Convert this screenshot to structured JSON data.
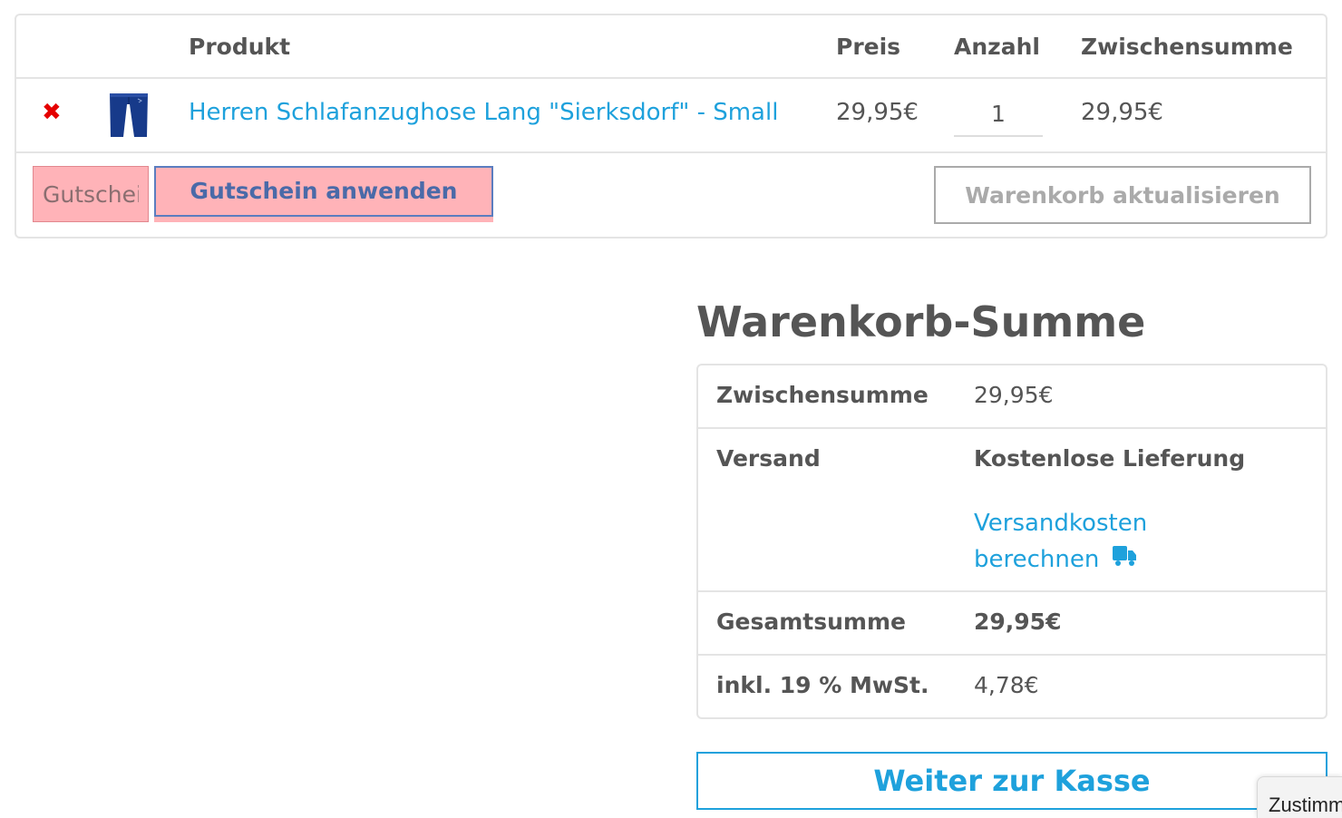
{
  "cart": {
    "headers": {
      "product": "Produkt",
      "price": "Preis",
      "quantity": "Anzahl",
      "subtotal": "Zwischensumme"
    },
    "items": [
      {
        "remove_icon": "close-icon",
        "name": "Herren Schlafanzughose Lang \"Sierksdorf\" - Small",
        "price": "29,95€",
        "quantity": "1",
        "subtotal": "29,95€"
      }
    ],
    "coupon": {
      "placeholder": "Gutscheincode",
      "apply_label": "Gutschein anwenden"
    },
    "update_label": "Warenkorb aktualisieren"
  },
  "totals": {
    "title": "Warenkorb-Summe",
    "subtotal_label": "Zwischensumme",
    "subtotal_value": "29,95€",
    "shipping_label": "Versand",
    "shipping_value": "Kostenlose Lieferung",
    "shipping_calc_line1": "Versandkosten",
    "shipping_calc_line2": "berechnen",
    "shipping_calc_icon": "truck-icon",
    "total_label": "Gesamtsumme",
    "total_value": "29,95€",
    "tax_label": "inkl. 19 % MwSt.",
    "tax_value": "4,78€"
  },
  "checkout_label": "Weiter zur Kasse",
  "consent_label": "Zustimmungen",
  "colors": {
    "link": "#1ea1dc",
    "remove": "#e50000",
    "highlight": "#ffb3b8",
    "text": "#555555",
    "border": "#e4e4e4"
  }
}
